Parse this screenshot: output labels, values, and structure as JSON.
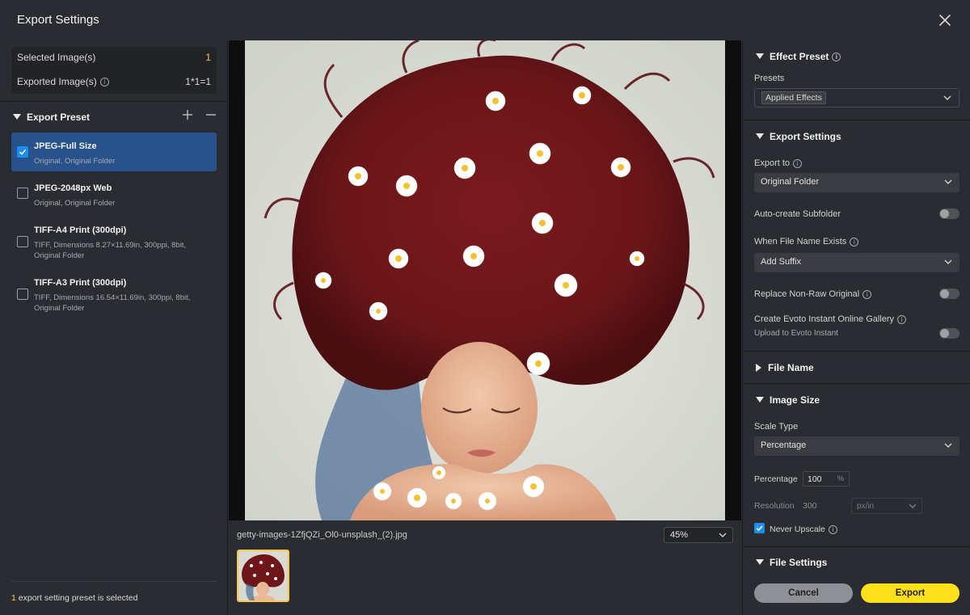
{
  "window": {
    "title": "Export Settings"
  },
  "summary": {
    "selected_label": "Selected Image(s)",
    "selected_value": "1",
    "exported_label": "Exported Image(s)",
    "exported_value": "1*1=1"
  },
  "export_preset": {
    "header": "Export Preset",
    "presets": [
      {
        "name": "JPEG-Full Size",
        "desc": "Original, Original Folder",
        "checked": true
      },
      {
        "name": "JPEG-2048px Web",
        "desc": "Original, Original Folder",
        "checked": false
      },
      {
        "name": "TIFF-A4 Print (300dpi)",
        "desc": "TIFF, Dimensions 8.27×11.69in, 300ppi, 8bit, Original Folder",
        "checked": false
      },
      {
        "name": "TIFF-A3 Print (300dpi)",
        "desc": "TIFF, Dimensions 16.54×11.69in, 300ppi, 8bit, Original Folder",
        "checked": false
      }
    ],
    "footer_count": "1",
    "footer_text": "export setting preset is selected"
  },
  "preview": {
    "filename": "getty-images-1ZfjQZi_Ol0-unsplash_(2).jpg",
    "zoom": "45%"
  },
  "effect_preset": {
    "header": "Effect Preset",
    "presets_label": "Presets",
    "presets_value": "Applied Effects"
  },
  "export_settings": {
    "header": "Export Settings",
    "export_to_label": "Export to",
    "export_to_value": "Original Folder",
    "auto_subfolder_label": "Auto-create Subfolder",
    "file_name_exists_label": "When File Name Exists",
    "file_name_exists_value": "Add Suffix",
    "replace_label": "Replace Non-Raw Original",
    "gallery_label": "Create Evoto Instant Online Gallery",
    "gallery_sub": "Upload to Evoto Instant"
  },
  "file_name": {
    "header": "File Name"
  },
  "image_size": {
    "header": "Image Size",
    "scale_type_label": "Scale Type",
    "scale_type_value": "Percentage",
    "percentage_label": "Percentage",
    "percentage_value": "100",
    "percentage_unit": "%",
    "resolution_label": "Resolution",
    "resolution_value": "300",
    "resolution_unit": "px/in",
    "never_upscale_label": "Never Upscale"
  },
  "file_settings": {
    "header": "File Settings"
  },
  "buttons": {
    "cancel": "Cancel",
    "export": "Export"
  },
  "colors": {
    "accent_yellow": "#ffe01a",
    "selection_blue": "#29528a",
    "checkbox_blue": "#1b8ef0"
  },
  "icons": [
    "close-icon",
    "plus-icon",
    "minus-icon",
    "info-icon",
    "checkmark-icon",
    "chevron-down-icon",
    "triangle-down-icon",
    "triangle-right-icon"
  ]
}
